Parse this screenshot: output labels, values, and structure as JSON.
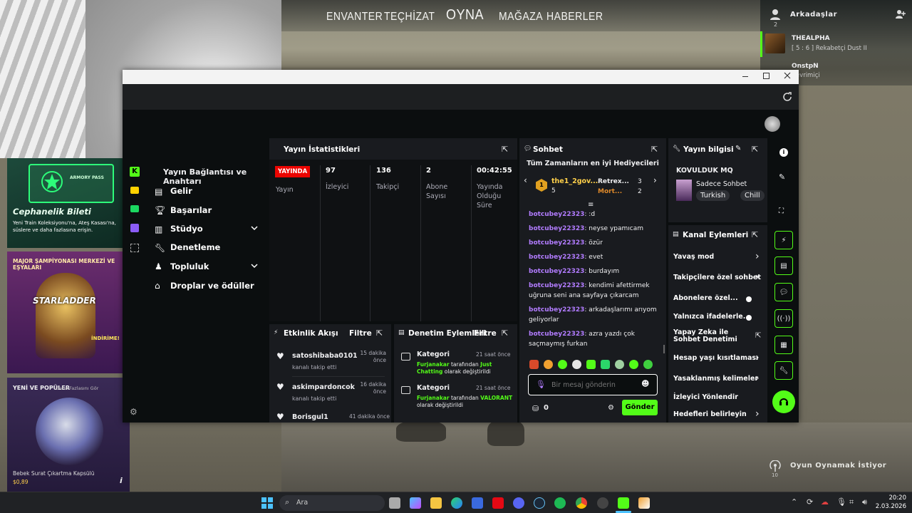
{
  "game": {
    "nav": [
      "ENVANTER",
      "TEÇHİZAT",
      "OYNA",
      "MAĞAZA",
      "HABERLER"
    ],
    "friends_title": "Arkadaşlar",
    "friends_count": "2",
    "friend1_name": "THEALPHA",
    "friend1_status": "[ 5 : 6 ] Rekabetçi Dust II",
    "friend2_name": "OnstpN",
    "friend2_status": "Çevrimiçi",
    "ad1_title": "Cephanelik Bileti",
    "ad1_desc": "Yeni Train Koleksiyonu'na, Ateş Kasası'na, süslere ve daha fazlasına erişin.",
    "ad1_badge": "ARMORY PASS",
    "ad2_title": "MAJOR ŞAMPİYONASI MERKEZİ VE EŞYALARI",
    "ad2_logo": "STARLADDER",
    "ad2_tag": "İNDİRİME!",
    "ad3_title": "YENİ VE POPÜLER",
    "ad3_more": "Daha Fazlasını Gör",
    "ad3_item": "Bebek Surat Çıkartma Kapsülü",
    "ad3_price": "$0,89",
    "looking": "Oyun Oynamak İstiyor",
    "looking_count": "10"
  },
  "kick": {
    "sidebar_header": "Yayın Bağlantısı ve Anahtarı",
    "menu": [
      "Gelir",
      "Başarılar",
      "Stüdyo",
      "Denetleme",
      "Topluluk",
      "Droplar ve ödüller"
    ],
    "stats": {
      "title": "Yayın İstatistikleri",
      "live_badge": "YAYINDA",
      "live_label": "Yayın",
      "viewers": "97",
      "viewers_label": "İzleyici",
      "followers": "136",
      "followers_label": "Takipçi",
      "subs": "2",
      "subs_label": "Abone Sayısı",
      "uptime": "00:42:55",
      "uptime_label": "Yayında Olduğu Süre"
    },
    "activity": {
      "title": "Etkinlik Akışı",
      "filter": "Filtre",
      "items": [
        {
          "user": "satoshibaba0101",
          "action": "kanalı takip etti",
          "time": "15 dakika önce"
        },
        {
          "user": "askimpardoncok",
          "action": "kanalı takip etti",
          "time": "16 dakika önce"
        },
        {
          "user": "Borisgul1",
          "action": "",
          "time": "41 dakika önce"
        }
      ]
    },
    "moderation": {
      "title": "Denetim Eylemleri",
      "filter": "Filtre",
      "items": [
        {
          "type": "Kategori",
          "time": "21 saat önce",
          "actor": "Furjanakar",
          "mid": "tarafından",
          "value": "Just Chatting",
          "tail": "olarak değiştirildi"
        },
        {
          "type": "Kategori",
          "time": "21 saat önce",
          "actor": "Furjanakar",
          "mid": "tarafından",
          "value": "VALORANT",
          "tail": "olarak değiştirildi"
        }
      ]
    },
    "chat": {
      "title": "Sohbet",
      "gifters_title": "Tüm Zamanların en iyi Hediyecileri",
      "gifter1": "the1_2gov...",
      "gifter1_count": "5",
      "gifter2": "Retrex...",
      "gifter2_count": "3",
      "gifter3": "Mort...",
      "gifter3_count": "2",
      "messages": [
        {
          "user": "botcubey22323",
          "text": ": :d"
        },
        {
          "user": "botcubey22323",
          "text": ": neyse ypamıcam"
        },
        {
          "user": "botcubey22323",
          "text": ": özür"
        },
        {
          "user": "botcubey22323",
          "text": ": evet"
        },
        {
          "user": "botcubey22323",
          "text": ": burdayım"
        },
        {
          "user": "botcubey22323",
          "text": ": kendimi afettirmek uğruna seni ana sayfaya çıkarcam"
        },
        {
          "user": "botcubey22323",
          "text": ": arkadaşlarımı arıyom geliyorlar"
        },
        {
          "user": "botcubey22323",
          "text": ": azra yazdı çok saçmaymış furkan"
        }
      ],
      "placeholder": "Bir mesaj gönderin",
      "points": "0",
      "send": "Gönder"
    },
    "info": {
      "title": "Yayın bilgisi",
      "stream_title": "KOVULDUK MQ",
      "category": "Sadece Sohbet",
      "tags": [
        "Turkish",
        "Chill"
      ]
    },
    "actions": {
      "title": "Kanal Eylemleri",
      "items": [
        "Yavaş mod",
        "Takipçilere özel sohbet",
        "Abonelere özel...",
        "Yalnızca ifadelerle...",
        "Yapay Zeka ile Sohbet Denetimi",
        "Hesap yaşı kısıtlaması",
        "Yasaklanmış kelimeler",
        "İzleyici Yönlendir",
        "Hedefleri belirleyin"
      ]
    }
  },
  "taskbar": {
    "search": "Ara",
    "time": "20:20",
    "date": "2.03.2026"
  },
  "colors": {
    "kick_green": "#53fc18",
    "live_red": "#eb0400",
    "panel": "#191b1f"
  }
}
